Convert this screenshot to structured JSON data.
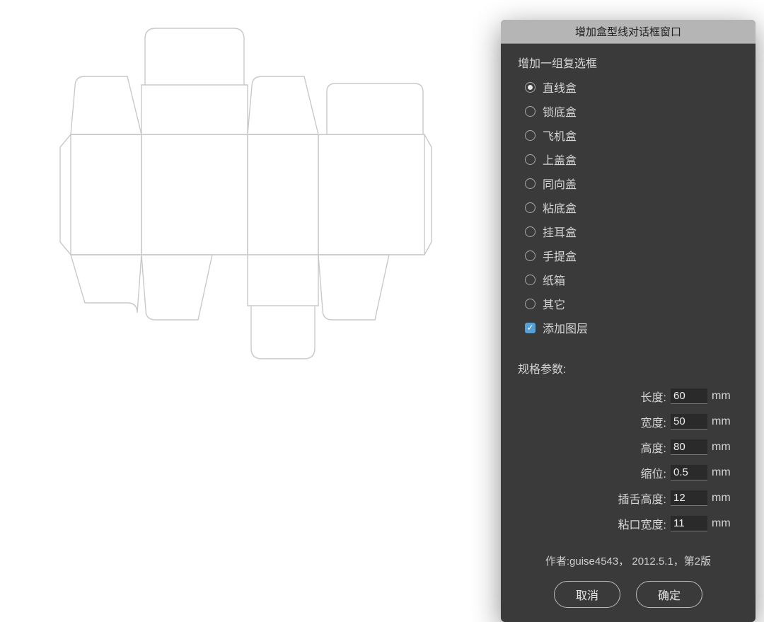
{
  "dialog": {
    "title": "增加盒型线对话框窗口",
    "group_label": "增加一组复选框",
    "box_types": [
      {
        "label": "直线盒",
        "selected": true
      },
      {
        "label": "锁底盒",
        "selected": false
      },
      {
        "label": "飞机盒",
        "selected": false
      },
      {
        "label": "上盖盒",
        "selected": false
      },
      {
        "label": "同向盖",
        "selected": false
      },
      {
        "label": "粘底盒",
        "selected": false
      },
      {
        "label": "挂耳盒",
        "selected": false
      },
      {
        "label": "手提盒",
        "selected": false
      },
      {
        "label": "纸箱",
        "selected": false
      },
      {
        "label": "其它",
        "selected": false
      }
    ],
    "add_layer": {
      "label": "添加图层",
      "checked": true
    },
    "params_label": "规格参数:",
    "params": [
      {
        "key": "length",
        "label": "长度:",
        "value": "60",
        "unit": "mm"
      },
      {
        "key": "width",
        "label": "宽度:",
        "value": "50",
        "unit": "mm"
      },
      {
        "key": "height",
        "label": "高度:",
        "value": "80",
        "unit": "mm"
      },
      {
        "key": "inset",
        "label": "缩位:",
        "value": "0.5",
        "unit": "mm"
      },
      {
        "key": "tongue_h",
        "label": "插舌高度:",
        "value": "12",
        "unit": "mm"
      },
      {
        "key": "glue_w",
        "label": "粘口宽度:",
        "value": "11",
        "unit": "mm"
      }
    ],
    "author_line": "作者:guise4543， 2012.5.1，第2版",
    "cancel_label": "取消",
    "ok_label": "确定"
  }
}
